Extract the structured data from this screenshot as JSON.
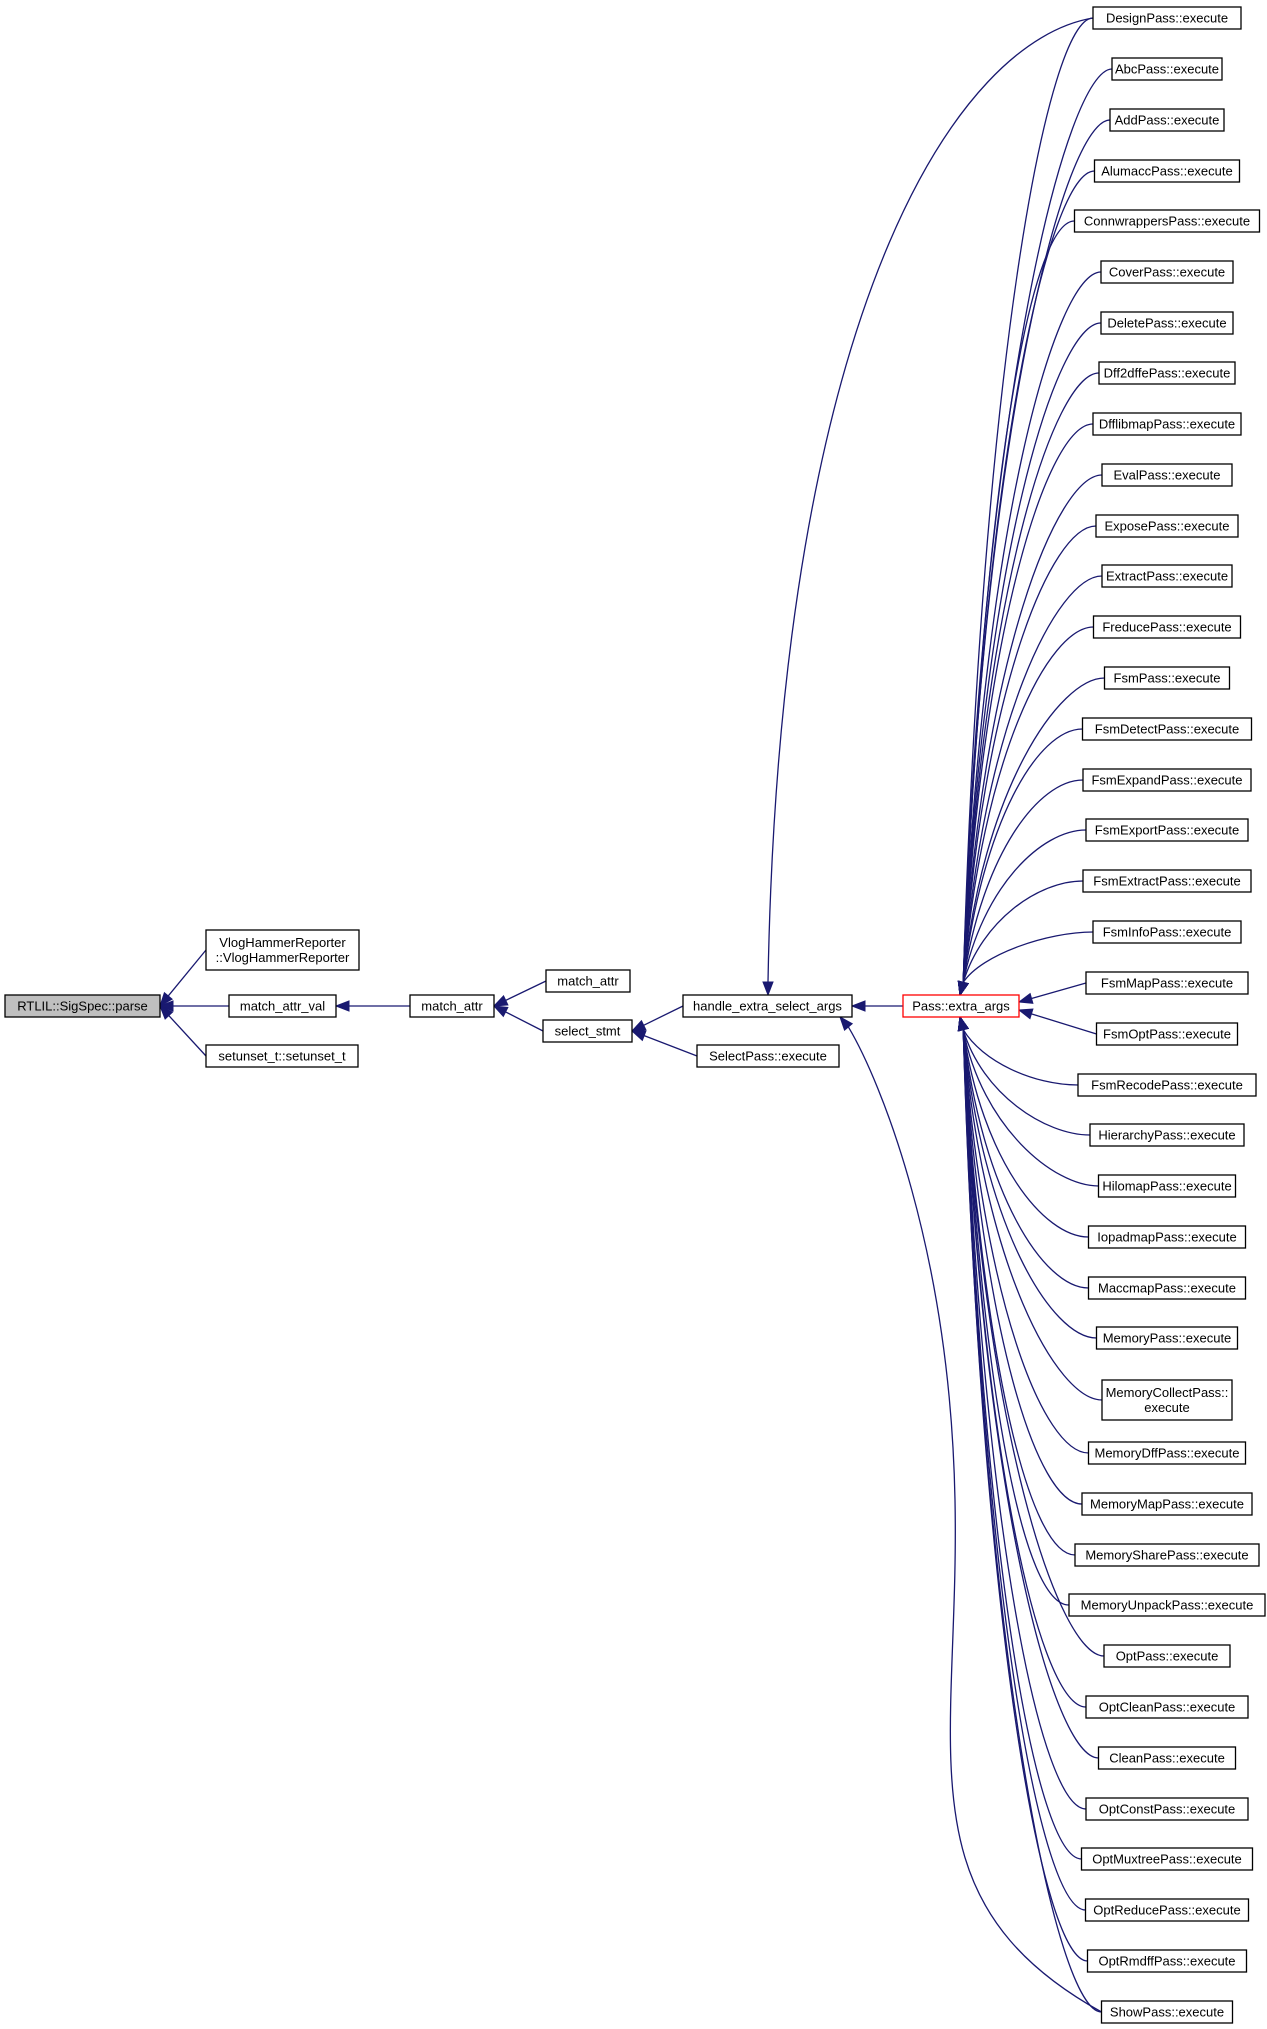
{
  "graph": {
    "root": "RTLIL::SigSpec::parse",
    "callers_level1": [
      "VlogHammerReporter\n::VlogHammerReporter",
      "match_attr_val",
      "setunset_t::setunset_t"
    ],
    "level2": "match_attr",
    "level3": [
      "match_attr",
      "select_stmt"
    ],
    "level4": [
      "handle_extra_select_args",
      "SelectPass::execute"
    ],
    "level5": "Pass::extra_args",
    "executes": [
      "DesignPass::execute",
      "AbcPass::execute",
      "AddPass::execute",
      "AlumaccPass::execute",
      "ConnwrappersPass::execute",
      "CoverPass::execute",
      "DeletePass::execute",
      "Dff2dffePass::execute",
      "DfflibmapPass::execute",
      "EvalPass::execute",
      "ExposePass::execute",
      "ExtractPass::execute",
      "FreducePass::execute",
      "FsmPass::execute",
      "FsmDetectPass::execute",
      "FsmExpandPass::execute",
      "FsmExportPass::execute",
      "FsmExtractPass::execute",
      "FsmInfoPass::execute",
      "FsmMapPass::execute",
      "FsmOptPass::execute",
      "FsmRecodePass::execute",
      "HierarchyPass::execute",
      "HilomapPass::execute",
      "IopadmapPass::execute",
      "MaccmapPass::execute",
      "MemoryPass::execute",
      "MemoryCollectPass::\nexecute",
      "MemoryDffPass::execute",
      "MemoryMapPass::execute",
      "MemorySharePass::execute",
      "MemoryUnpackPass::execute",
      "OptPass::execute",
      "OptCleanPass::execute",
      "CleanPass::execute",
      "OptConstPass::execute",
      "OptMuxtreePass::execute",
      "OptReducePass::execute",
      "OptRmdffPass::execute",
      "ShowPass::execute"
    ]
  },
  "colors": {
    "edge": "#191970",
    "root_fill": "#bfbfbf",
    "highlight_border": "#ff0000"
  }
}
